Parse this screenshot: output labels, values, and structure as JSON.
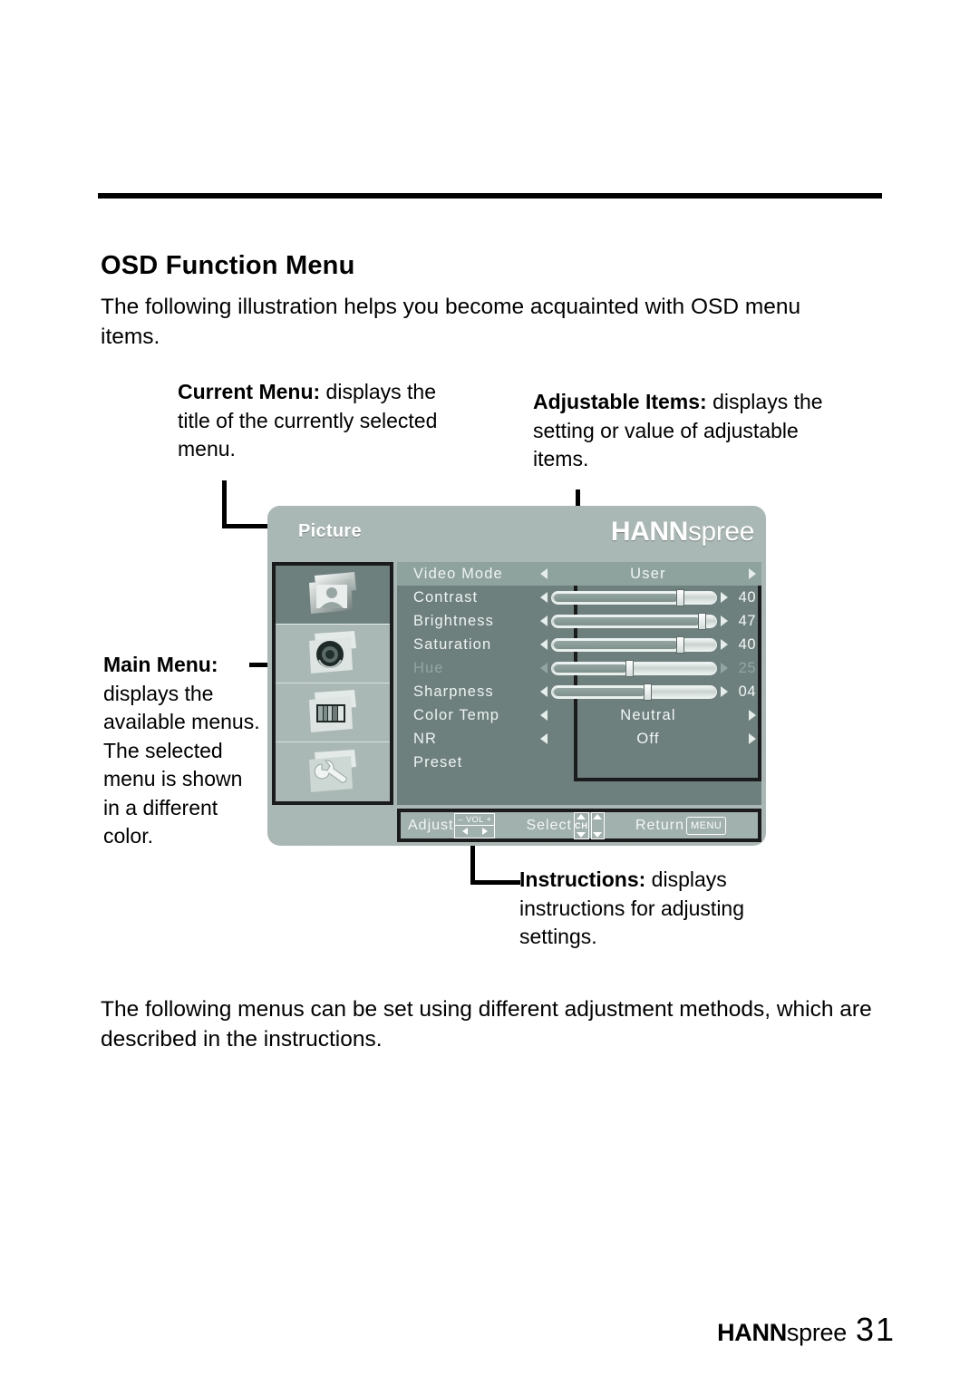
{
  "page": {
    "title": "OSD Function Menu",
    "intro": "The following illustration helps you become acquainted with OSD menu items.",
    "closing": "The following menus can be set using different adjustment methods, which are described in the instructions.",
    "footer_brand_bold": "HANN",
    "footer_brand_light": "spree",
    "page_number": "31"
  },
  "callouts": {
    "current_menu": {
      "term": "Current Menu:",
      "text": " displays the title of the currently selected menu."
    },
    "adjustable_items": {
      "term": "Adjustable Items:",
      "text": " displays the setting or value of adjustable items."
    },
    "main_menu": {
      "term": "Main Menu:",
      "text": " displays the available menus. The selected menu is shown in a different color."
    },
    "instructions": {
      "term": "Instructions:",
      "text": " displays instructions for adjusting settings."
    }
  },
  "osd": {
    "current_tab": "Picture",
    "brand_bold": "HANN",
    "brand_light": "spree",
    "icons": [
      {
        "name": "picture-icon",
        "selected": true
      },
      {
        "name": "audio-dial-icon",
        "selected": false
      },
      {
        "name": "screen-icon",
        "selected": false
      },
      {
        "name": "wrench-setup-icon",
        "selected": false
      }
    ],
    "items": [
      {
        "label": "Video Mode",
        "type": "option",
        "value": "User",
        "selected": true,
        "disabled": false
      },
      {
        "label": "Contrast",
        "type": "slider",
        "value": "40",
        "percent": 78,
        "selected": false,
        "disabled": false
      },
      {
        "label": "Brightness",
        "type": "slider",
        "value": "47",
        "percent": 91,
        "selected": false,
        "disabled": false
      },
      {
        "label": "Saturation",
        "type": "slider",
        "value": "40",
        "percent": 78,
        "selected": false,
        "disabled": false
      },
      {
        "label": "Hue",
        "type": "slider",
        "value": "25",
        "percent": 47,
        "selected": false,
        "disabled": true
      },
      {
        "label": "Sharpness",
        "type": "slider",
        "value": "04",
        "percent": 58,
        "selected": false,
        "disabled": false
      },
      {
        "label": "Color Temp",
        "type": "option",
        "value": "Neutral",
        "selected": false,
        "disabled": false
      },
      {
        "label": "NR",
        "type": "option",
        "value": "Off",
        "selected": false,
        "disabled": false
      },
      {
        "label": "Preset",
        "type": "none",
        "value": "",
        "selected": false,
        "disabled": false
      }
    ],
    "instructions_bar": {
      "adjust_label": "Adjust",
      "vol_key_label": "VOL",
      "vol_minus": "–",
      "vol_plus": "+",
      "select_label": "Select",
      "ch_key_label": "CH",
      "return_label": "Return",
      "menu_key_label": "MENU"
    },
    "colors": {
      "shell": "#a9b8b4",
      "panel_dark": "#6e807d",
      "row_highlight": "#8ea29e",
      "text": "#f2f7f5",
      "text_disabled": "#93a5a1",
      "outline": "#1b1b1b"
    }
  }
}
